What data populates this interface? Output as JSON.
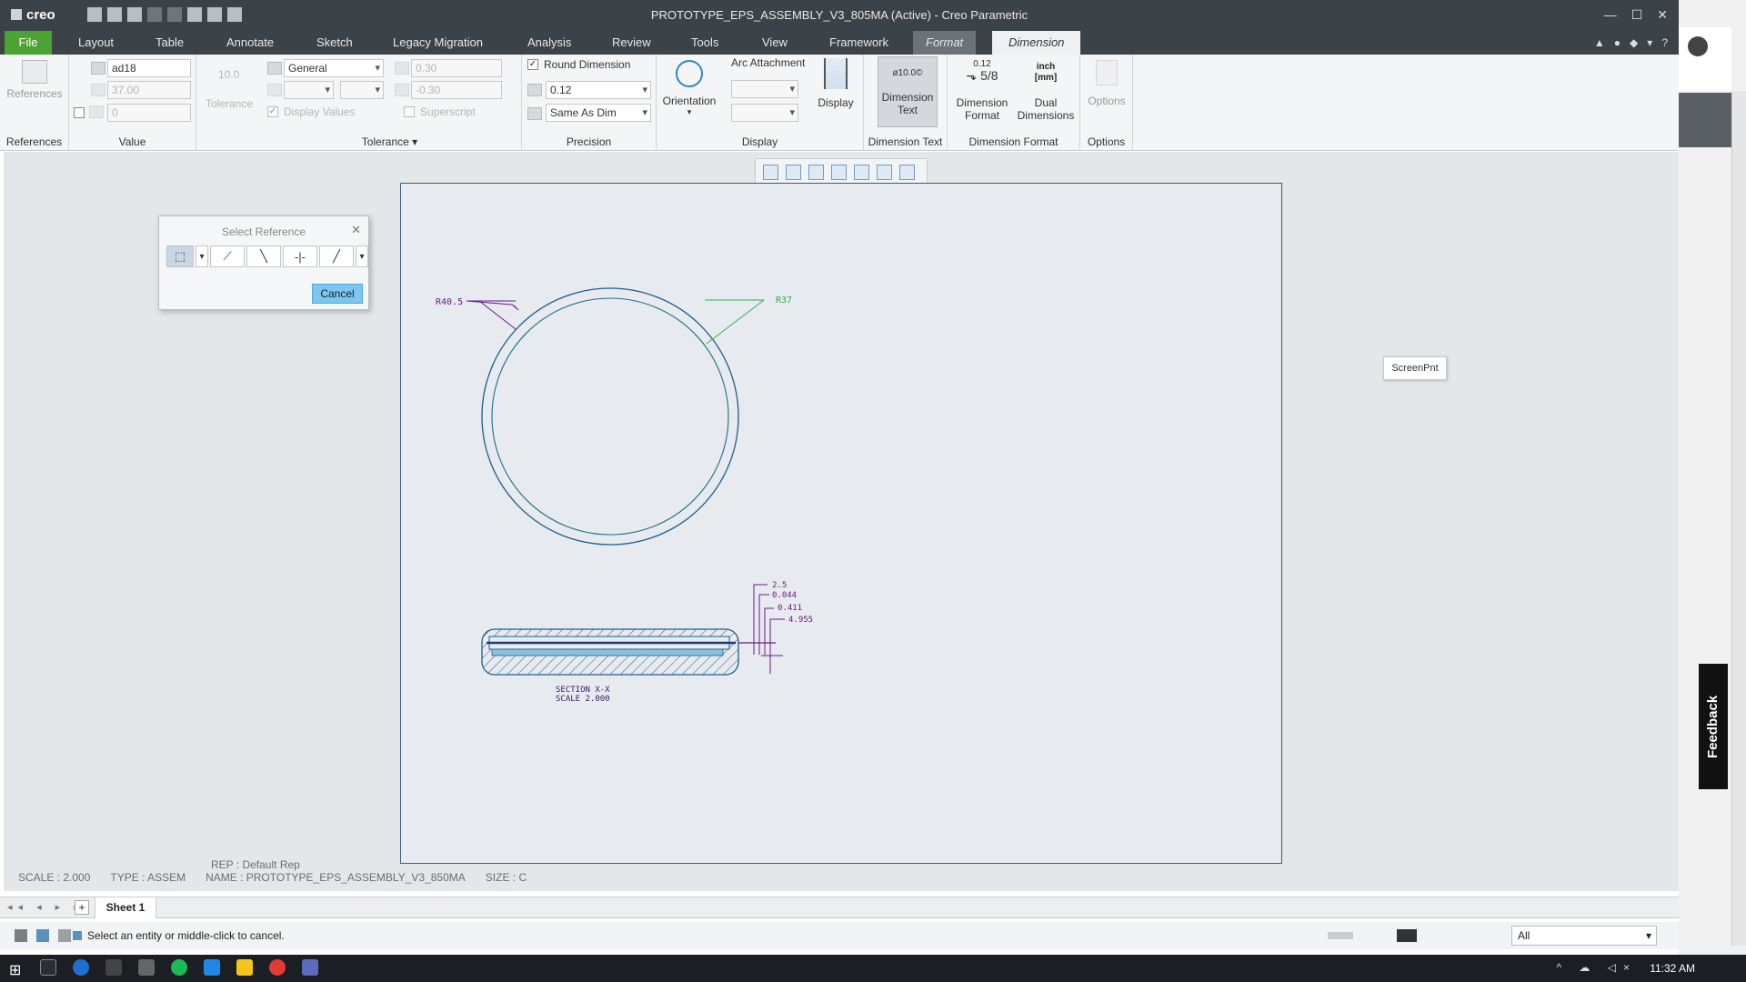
{
  "app": {
    "logo": "creo",
    "title": "PROTOTYPE_EPS_ASSEMBLY_V3_805MA (Active) - Creo Parametric",
    "window_controls": [
      "—",
      "☐",
      "✕"
    ]
  },
  "tabs": {
    "file": "File",
    "items": [
      "Layout",
      "Table",
      "Annotate",
      "Sketch",
      "Legacy Migration",
      "Analysis",
      "Review",
      "Tools",
      "View",
      "Framework"
    ],
    "format": "Format",
    "dimension": "Dimension"
  },
  "ribbon": {
    "references": {
      "button": "References",
      "group": "References"
    },
    "value": {
      "group": "Value",
      "name": "ad18",
      "nominal": "37.00",
      "override": "0",
      "tolerance_label": "Tolerance",
      "tolerance_icon_text": "10.0"
    },
    "tolerance": {
      "group": "Tolerance",
      "type": "General",
      "upper": "0.30",
      "lower": "-0.30",
      "display_values": "Display Values",
      "superscript": "Superscript"
    },
    "precision": {
      "group": "Precision",
      "round_dimension": "Round Dimension",
      "decimals": "0.12",
      "tol_decimals": "Same As Dim"
    },
    "display": {
      "group": "Display",
      "orientation": "Orientation",
      "arc_attachment": "Arc Attachment",
      "display_button": "Display"
    },
    "dimension_text": {
      "group": "Dimension Text",
      "button_line1": "Dimension",
      "button_line2": "Text",
      "icon_text": "ø10.0©"
    },
    "dimension_format": {
      "group": "Dimension Format",
      "format_line1": "Dimension",
      "format_line2": "Format",
      "format_icon_top": "0.12",
      "format_icon_frac": "5/8",
      "dual_line1": "Dual",
      "dual_line2": "Dimensions",
      "dual_icon_top": "inch",
      "dual_icon_bottom": "[mm]"
    },
    "options": {
      "group": "Options",
      "button": "Options"
    }
  },
  "dialog": {
    "title": "Select Reference",
    "tools": [
      "⬚",
      "⟋",
      "╲",
      "-|-",
      "╱"
    ],
    "cancel": "Cancel"
  },
  "screenpnt": "ScreenPnt",
  "drawing": {
    "dim_r405": "R40.5",
    "dim_r37": "R37",
    "dims_section": [
      "2.5",
      "0.044",
      "0.411",
      "4.955"
    ],
    "section_label": "SECTION X-X",
    "section_scale": "SCALE 2.000",
    "colors": {
      "outline": "#1e5f8e",
      "green": "#2bb24a",
      "purple": "#6a1a8a",
      "hatch": "#1e5f8e"
    }
  },
  "info": {
    "rep": "REP : Default Rep",
    "scale": "SCALE : 2.000",
    "type": "TYPE : ASSEM",
    "name": "NAME : PROTOTYPE_EPS_ASSEMBLY_V3_850MA",
    "size": "SIZE : C"
  },
  "sheet_tab": "Sheet 1",
  "sheet_add": "+",
  "status": {
    "message": "Select an entity or middle-click to cancel.",
    "filter": "All"
  },
  "feedback": "Feedback",
  "taskbar": {
    "time": "11:32 AM"
  }
}
